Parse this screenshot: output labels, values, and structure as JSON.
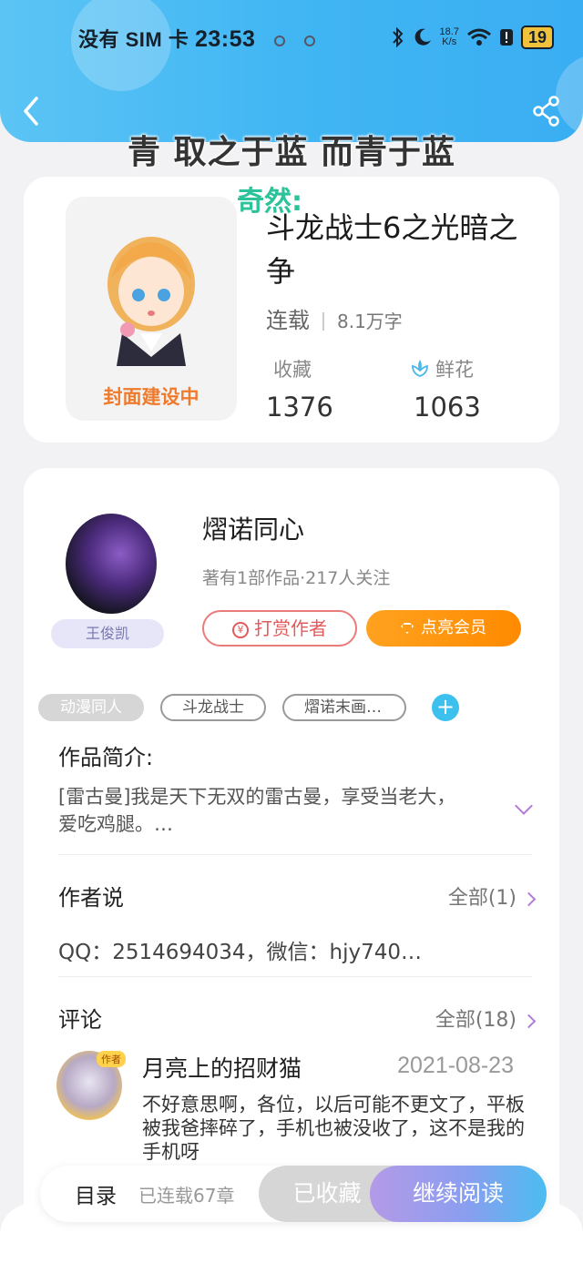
{
  "status": {
    "carrier": "没有 SIM 卡",
    "time": "23:53",
    "speed_top": "18.7",
    "speed_unit": "K/s",
    "battery": "19"
  },
  "overlay": {
    "title": "青 取之于蓝 而青于蓝",
    "float_text": "奇然:"
  },
  "book": {
    "cover_text": "封面建设中",
    "title": "斗龙战士6之光暗之争",
    "status": "连载",
    "words": "8.1万字",
    "fav_label": "收藏",
    "fav_count": "1376",
    "flower_label": "鲜花",
    "flower_count": "1063"
  },
  "author": {
    "name": "熠诺同心",
    "meta": "著有1部作品·217人关注",
    "badge": "王俊凯",
    "tip_label": "打赏作者",
    "vip_label": "点亮会员"
  },
  "tags": [
    "动漫同人",
    "斗龙战士",
    "熠诺末画…"
  ],
  "intro": {
    "title": "作品简介:",
    "text": "[雷古曼]我是天下无双的雷古曼，享受当老大，爱吃鸡腿。…"
  },
  "author_says": {
    "title": "作者说",
    "link": "全部(1)",
    "text": "QQ：2514694034，微信：hjy740…"
  },
  "comments": {
    "title": "评论",
    "link": "全部(18)",
    "item": {
      "badge": "作者",
      "name": "月亮上的招财猫",
      "date": "2021-08-23",
      "text": "不好意思啊，各位，以后可能不更文了，平板被我爸摔碎了，手机也被没收了，这不是我的手机呀"
    }
  },
  "bottom": {
    "toc": "目录",
    "chapters": "已连载67章",
    "favorited": "已收藏",
    "continue": "继续阅读"
  },
  "colors": {
    "header_blue": "#41b6f3",
    "vip_orange": "#ff8a00",
    "tip_red": "#e25b5b",
    "tag_add": "#3cc0ee"
  }
}
